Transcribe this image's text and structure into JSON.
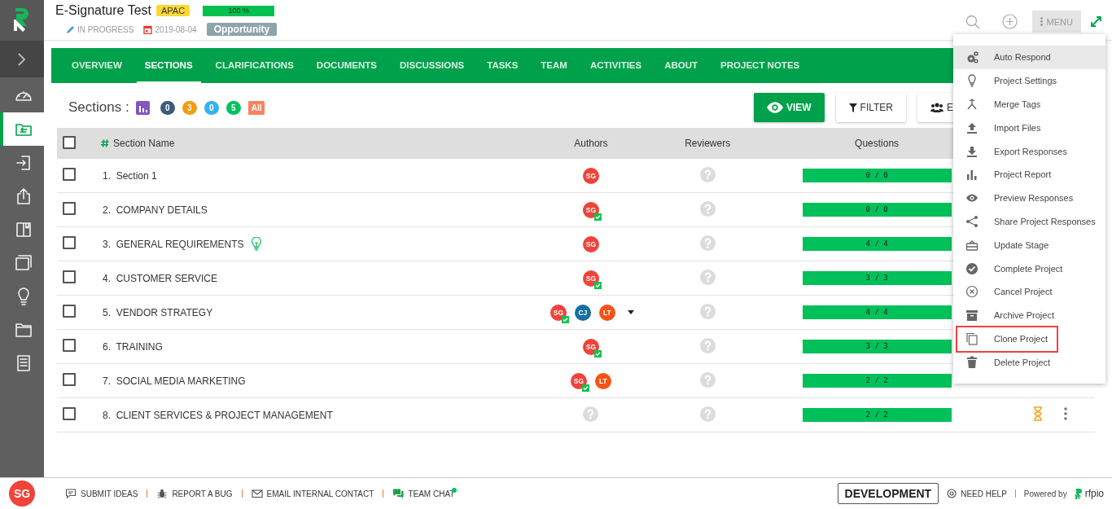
{
  "sidebar": {
    "items": [
      {
        "kind": "dashboard",
        "selected": false
      },
      {
        "kind": "projects",
        "selected": true
      },
      {
        "kind": "import",
        "selected": false
      },
      {
        "kind": "export",
        "selected": false
      },
      {
        "kind": "library",
        "selected": false
      },
      {
        "kind": "windows",
        "selected": false
      },
      {
        "kind": "ideas",
        "selected": false
      },
      {
        "kind": "folder",
        "selected": false
      },
      {
        "kind": "document",
        "selected": false
      }
    ],
    "user": {
      "initials": "SG"
    }
  },
  "project": {
    "title": "E-Signature Test",
    "region": "APAC",
    "progress": {
      "level": 1,
      "reading": "100 %"
    },
    "status": "IN PROGRESS",
    "date": "2019-08-04",
    "stage": "Opportunity"
  },
  "toolbar": {
    "menu_label": "MENU",
    "menu_open": true
  },
  "tabs": [
    {
      "label": "OVERVIEW",
      "selected": false
    },
    {
      "label": "SECTIONS",
      "selected": true
    },
    {
      "label": "CLARIFICATIONS",
      "selected": false
    },
    {
      "label": "DOCUMENTS",
      "selected": false
    },
    {
      "label": "DISCUSSIONS",
      "selected": false
    },
    {
      "label": "TASKS",
      "selected": false
    },
    {
      "label": "TEAM",
      "selected": false
    },
    {
      "label": "ACTIVITIES",
      "selected": false
    },
    {
      "label": "ABOUT",
      "selected": false
    },
    {
      "label": "PROJECT NOTES",
      "selected": false
    }
  ],
  "sections": {
    "label": "Sections :",
    "counts": [
      {
        "value": "0",
        "color": "#3d5a7c",
        "kind": "count"
      },
      {
        "value": "3",
        "color": "#f39c12",
        "kind": "count"
      },
      {
        "value": "0",
        "color": "#35b3f0",
        "kind": "count"
      },
      {
        "value": "5",
        "color": "#00c060",
        "kind": "count"
      },
      {
        "value": "All",
        "color": "#f7845e",
        "kind": "all"
      }
    ],
    "buttons": [
      {
        "label": "VIEW",
        "kind": "view"
      },
      {
        "label": "FILTER",
        "kind": "filter"
      },
      {
        "label": "E",
        "kind": "team"
      }
    ]
  },
  "table": {
    "select_all": {
      "checked": false
    },
    "columns": [
      "Section Name",
      "Authors",
      "Reviewers",
      "Questions"
    ],
    "rows": [
      {
        "checked": false,
        "number": "1.",
        "name": "Section 1",
        "hint": false,
        "more": false,
        "authors": [
          {
            "initials": "SG",
            "color": "#f0433a",
            "checked": false
          }
        ],
        "questions": {
          "reading": "0 / 0",
          "level": 1
        },
        "pending": false,
        "actions": false
      },
      {
        "checked": false,
        "number": "2.",
        "name": "COMPANY DETAILS",
        "hint": false,
        "more": false,
        "authors": [
          {
            "initials": "SG",
            "color": "#f0433a",
            "checked": true
          }
        ],
        "questions": {
          "reading": "0 / 0",
          "level": 1
        },
        "pending": false,
        "actions": false
      },
      {
        "checked": false,
        "number": "3.",
        "name": "GENERAL REQUIREMENTS",
        "hint": true,
        "more": false,
        "authors": [
          {
            "initials": "SG",
            "color": "#f0433a",
            "checked": false
          }
        ],
        "questions": {
          "reading": "4 / 4",
          "level": 1
        },
        "pending": false,
        "actions": false
      },
      {
        "checked": false,
        "number": "4.",
        "name": "CUSTOMER SERVICE",
        "hint": false,
        "more": false,
        "authors": [
          {
            "initials": "SG",
            "color": "#f0433a",
            "checked": true
          }
        ],
        "questions": {
          "reading": "3 / 3",
          "level": 1
        },
        "pending": false,
        "actions": false
      },
      {
        "checked": false,
        "number": "5.",
        "name": "VENDOR STRATEGY",
        "hint": false,
        "more": true,
        "authors": [
          {
            "initials": "SG",
            "color": "#f0433a",
            "checked": true
          },
          {
            "initials": "CJ",
            "color": "#1670a0",
            "checked": false
          },
          {
            "initials": "LT",
            "color": "#f45318",
            "checked": false
          }
        ],
        "questions": {
          "reading": "4 / 4",
          "level": 1
        },
        "pending": false,
        "actions": false
      },
      {
        "checked": false,
        "number": "6.",
        "name": "TRAINING",
        "hint": false,
        "more": false,
        "authors": [
          {
            "initials": "SG",
            "color": "#f0433a",
            "checked": true
          }
        ],
        "questions": {
          "reading": "3 / 3",
          "level": 1
        },
        "pending": false,
        "actions": false
      },
      {
        "checked": false,
        "number": "7.",
        "name": "SOCIAL MEDIA MARKETING",
        "hint": false,
        "more": false,
        "authors": [
          {
            "initials": "SG",
            "color": "#f0433a",
            "checked": true
          },
          {
            "initials": "LT",
            "color": "#f45318",
            "checked": false
          }
        ],
        "questions": {
          "reading": "2 / 2",
          "level": 1
        },
        "pending": false,
        "actions": false
      },
      {
        "checked": false,
        "number": "8.",
        "name": "CLIENT SERVICES & PROJECT MANAGEMENT",
        "hint": false,
        "more": false,
        "questions": {
          "reading": "2 / 2",
          "level": 1
        },
        "pending": true,
        "actions": true
      }
    ]
  },
  "menu": {
    "items": [
      {
        "kind": "auto",
        "label": "Auto Respond",
        "selected": true,
        "outlined": false
      },
      {
        "kind": "settings",
        "label": "Project Settings",
        "selected": false,
        "outlined": false
      },
      {
        "kind": "merge",
        "label": "Merge Tags",
        "selected": false,
        "outlined": false
      },
      {
        "kind": "import",
        "label": "Import Files",
        "selected": false,
        "outlined": false
      },
      {
        "kind": "export",
        "label": "Export Responses",
        "selected": false,
        "outlined": false
      },
      {
        "kind": "report",
        "label": "Project Report",
        "selected": false,
        "outlined": false
      },
      {
        "kind": "preview",
        "label": "Preview Responses",
        "selected": false,
        "outlined": false
      },
      {
        "kind": "share",
        "label": "Share Project Responses",
        "selected": false,
        "outlined": false
      },
      {
        "kind": "stage",
        "label": "Update Stage",
        "selected": false,
        "outlined": false
      },
      {
        "kind": "complete",
        "label": "Complete Project",
        "selected": false,
        "outlined": false
      },
      {
        "kind": "cancel",
        "label": "Cancel Project",
        "selected": false,
        "outlined": false
      },
      {
        "kind": "archive",
        "label": "Archive Project",
        "selected": false,
        "outlined": false
      },
      {
        "kind": "clone",
        "label": "Clone Project",
        "selected": false,
        "outlined": true
      },
      {
        "kind": "delete",
        "label": "Delete Project",
        "selected": false,
        "outlined": false
      }
    ]
  },
  "footer": {
    "links": [
      {
        "kind": "ideas",
        "label": "SUBMIT IDEAS",
        "online": false
      },
      {
        "kind": "bug",
        "label": "REPORT A BUG",
        "online": false
      },
      {
        "kind": "mail",
        "label": "EMAIL INTERNAL CONTACT",
        "online": false
      },
      {
        "kind": "chat",
        "label": "TEAM CHAT",
        "online": true
      }
    ],
    "environment": "DEVELOPMENT",
    "help": "NEED HELP",
    "powered": "Powered by",
    "brand": "rfpio"
  }
}
